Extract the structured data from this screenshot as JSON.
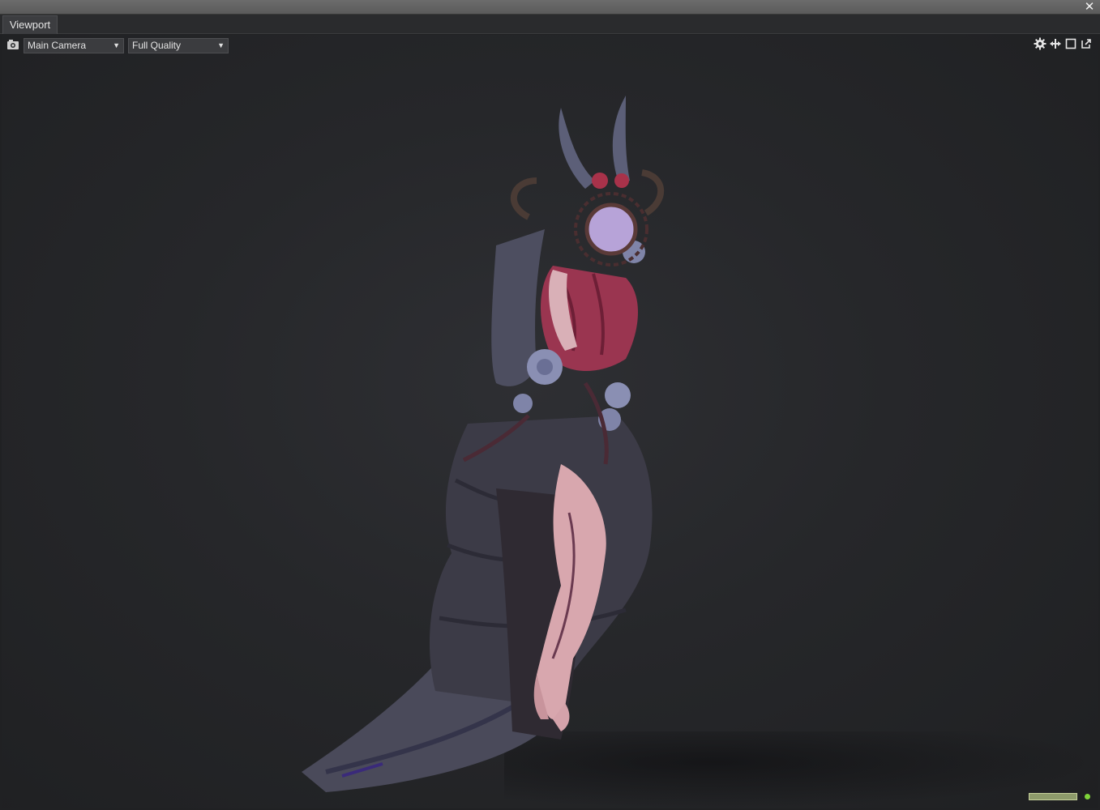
{
  "window": {
    "close_icon": "close-icon"
  },
  "tabs": [
    {
      "label": "Viewport",
      "active": true
    }
  ],
  "toolbar": {
    "camera_icon": "camera-icon",
    "camera_select": {
      "value": "Main Camera"
    },
    "quality_select": {
      "value": "Full Quality"
    },
    "right_icons": [
      "gear-icon",
      "move-icon",
      "maximize-icon",
      "popout-icon"
    ]
  },
  "viewport": {
    "subject": "3d-character-model",
    "status_indicator_color": "#7fd43a"
  },
  "colors": {
    "accent": "#8d9a6a",
    "background": "#202123",
    "status_ok": "#7fd43a"
  }
}
